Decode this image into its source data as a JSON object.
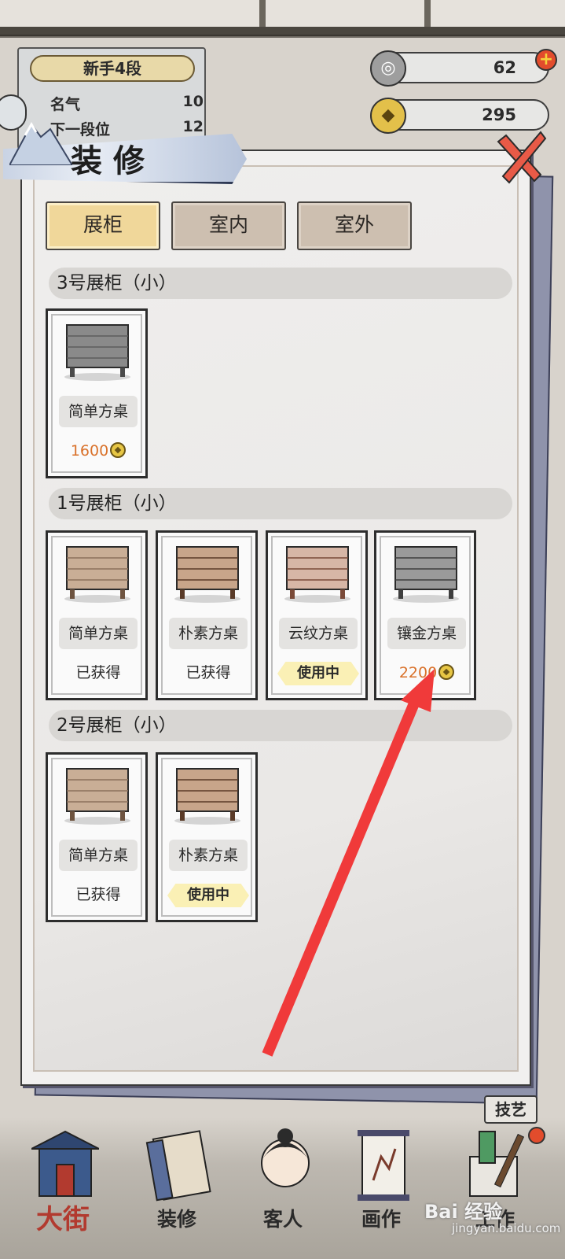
{
  "rank": {
    "title": "新手4段",
    "rows": [
      {
        "label": "名气",
        "value": "10"
      },
      {
        "label": "下一段位",
        "value": "12"
      }
    ]
  },
  "currency": {
    "jade": "62",
    "coins": "295"
  },
  "dialog": {
    "title": "装修",
    "tabs": [
      {
        "label": "展柜",
        "active": true
      },
      {
        "label": "室内",
        "active": false
      },
      {
        "label": "室外",
        "active": false
      }
    ],
    "sections": [
      {
        "header": "3号展柜（小）",
        "items": [
          {
            "name": "简单方桌",
            "status": "1600",
            "status_type": "price",
            "wood": "gray"
          }
        ]
      },
      {
        "header": "1号展柜（小）",
        "items": [
          {
            "name": "简单方桌",
            "status": "已获得",
            "status_type": "owned",
            "wood": "light"
          },
          {
            "name": "朴素方桌",
            "status": "已获得",
            "status_type": "owned",
            "wood": "brown"
          },
          {
            "name": "云纹方桌",
            "status": "使用中",
            "status_type": "inuse",
            "wood": "pink"
          },
          {
            "name": "镶金方桌",
            "status": "2200",
            "status_type": "price",
            "wood": "silver"
          }
        ]
      },
      {
        "header": "2号展柜（小）",
        "items": [
          {
            "name": "简单方桌",
            "status": "已获得",
            "status_type": "owned",
            "wood": "light"
          },
          {
            "name": "朴素方桌",
            "status": "使用中",
            "status_type": "inuse",
            "wood": "brown"
          }
        ]
      }
    ]
  },
  "bottom_nav": [
    {
      "label": "大街"
    },
    {
      "label": "装修"
    },
    {
      "label": "客人"
    },
    {
      "label": "画作"
    },
    {
      "label": "工作"
    }
  ],
  "skill_button": "技艺",
  "watermark": {
    "brand": "Bai 经验",
    "sub": "jingyan.baidu.com"
  },
  "colors": {
    "price_orange": "#d9712a",
    "tab_active": "#f0d79a",
    "tab_inactive": "#cdbfb0",
    "arrow_red": "#f03a3a"
  }
}
